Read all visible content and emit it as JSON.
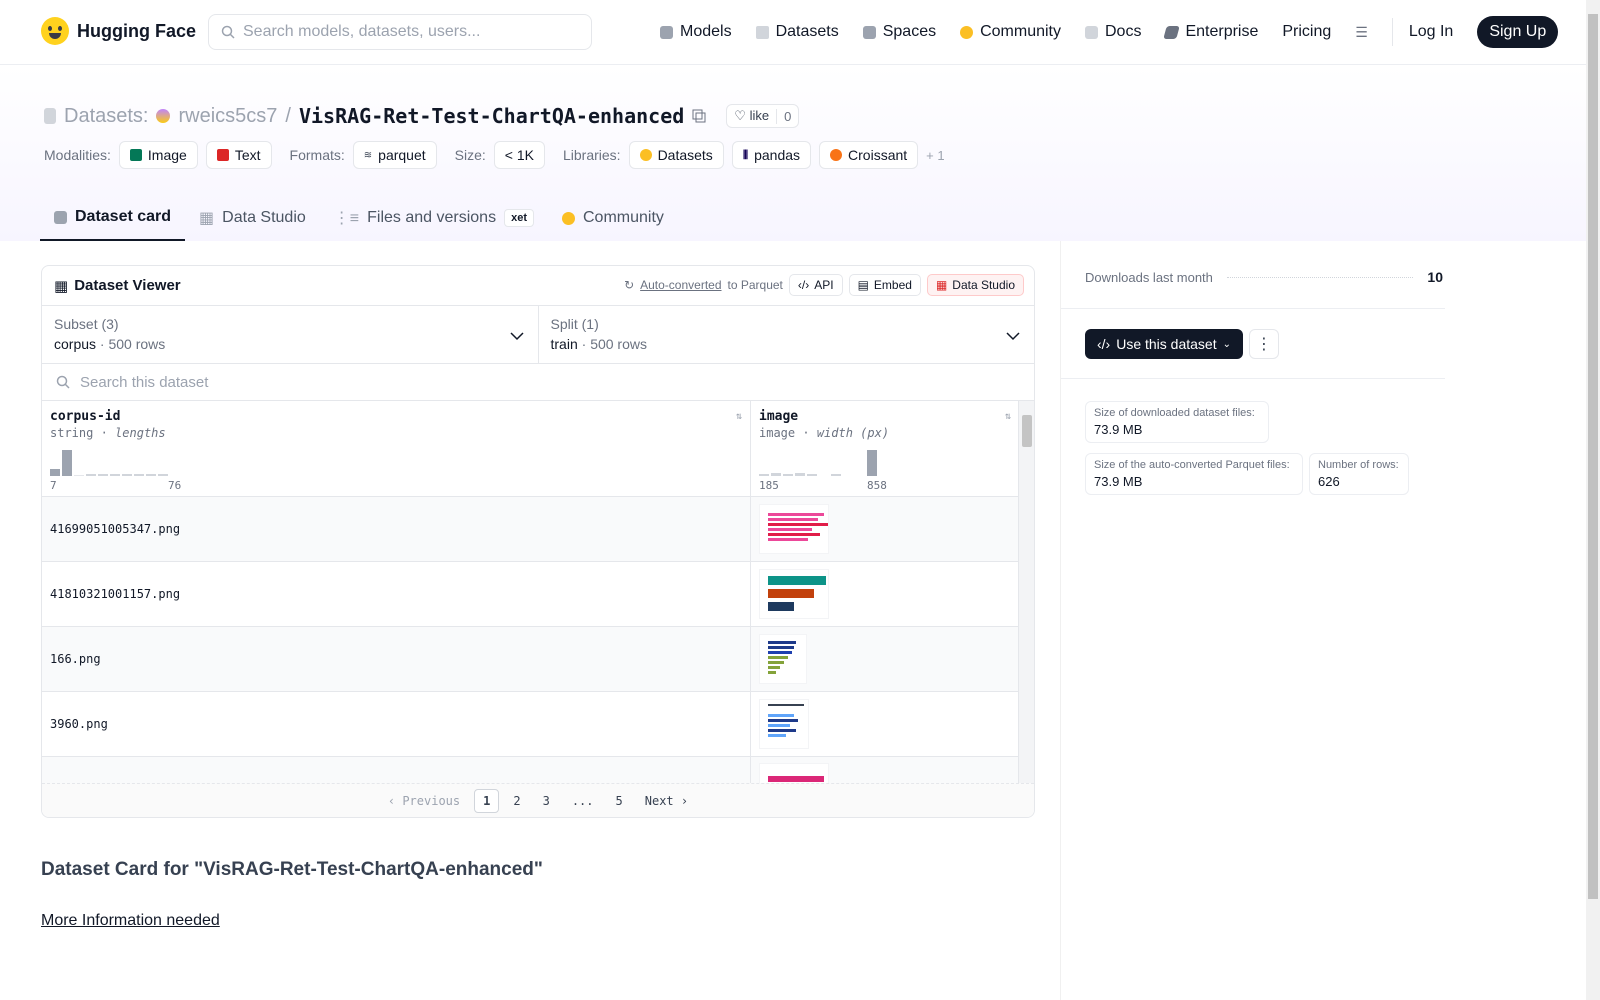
{
  "header": {
    "brand": "Hugging Face",
    "search_placeholder": "Search models, datasets, users...",
    "nav": [
      {
        "label": "Models",
        "color": "#9ca3af"
      },
      {
        "label": "Datasets",
        "color": "#d1d5db"
      },
      {
        "label": "Spaces",
        "color": "#9ca3af"
      },
      {
        "label": "Community",
        "color": "#fbbf24"
      },
      {
        "label": "Docs",
        "color": "#9ca3af"
      },
      {
        "label": "Enterprise",
        "color": "#6b7280"
      },
      {
        "label": "Pricing",
        "color": ""
      }
    ],
    "login": "Log In",
    "signup": "Sign Up"
  },
  "dataset": {
    "section": "Datasets:",
    "owner": "rweics5cs7",
    "name": "VisRAG-Ret-Test-ChartQA-enhanced",
    "like": "like",
    "likes": "0"
  },
  "tags": {
    "modalities_label": "Modalities:",
    "modalities": [
      "Image",
      "Text"
    ],
    "formats_label": "Formats:",
    "formats": [
      "parquet"
    ],
    "size_label": "Size:",
    "size": "< 1K",
    "libraries_label": "Libraries:",
    "libraries": [
      "Datasets",
      "pandas",
      "Croissant"
    ],
    "more": "+ 1"
  },
  "tabs": [
    "Dataset card",
    "Data Studio",
    "Files and versions",
    "Community"
  ],
  "xet": "xet",
  "viewer": {
    "title": "Dataset Viewer",
    "auto": "Auto-converted",
    "to": "to Parquet",
    "api": "API",
    "embed": "Embed",
    "studio": "Data Studio",
    "subset_label": "Subset (3)",
    "subset": "corpus",
    "subset_rows": "500 rows",
    "split_label": "Split (1)",
    "split": "train",
    "split_rows": "500 rows",
    "search_placeholder": "Search this dataset",
    "col1": {
      "name": "corpus-id",
      "type": "string",
      "meta": "lengths",
      "min": "7",
      "max": "76"
    },
    "col2": {
      "name": "image",
      "type": "image",
      "meta": "width (px)",
      "min": "185",
      "max": "858"
    },
    "rows": [
      "41699051005347.png",
      "41810321001157.png",
      "166.png",
      "3960.png",
      ""
    ],
    "pager": {
      "prev": "Previous",
      "pages": [
        "1",
        "2",
        "3",
        "...",
        "5"
      ],
      "next": "Next"
    }
  },
  "card": {
    "title": "Dataset Card for \"VisRAG-Ret-Test-ChartQA-enhanced\"",
    "more": "More Information needed"
  },
  "sidebar": {
    "downloads_label": "Downloads last month",
    "downloads": "10",
    "use": "Use this dataset",
    "size_dl_label": "Size of downloaded dataset files:",
    "size_dl": "73.9 MB",
    "size_pq_label": "Size of the auto-converted Parquet files:",
    "size_pq": "73.9 MB",
    "rows_label": "Number of rows:",
    "rows": "626"
  }
}
